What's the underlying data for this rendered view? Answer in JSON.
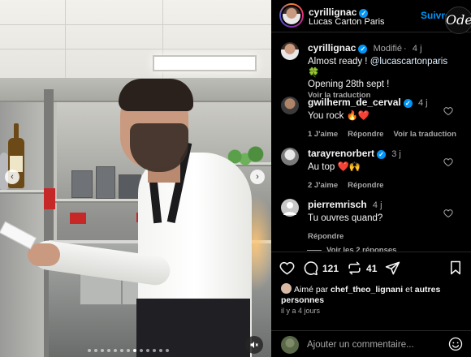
{
  "header": {
    "username": "cyrillignac",
    "location": "Lucas Carton Paris",
    "follow_label": "Suivre",
    "watermark": "Ode"
  },
  "caption": {
    "username": "cyrillignac",
    "modified": "Modifié",
    "time": "4 j",
    "line1": "Almost ready ! ",
    "mention": "@lucascartonparis",
    "clover": "🍀",
    "line2": "Opening 28th sept !",
    "translate": "Voir la traduction"
  },
  "comments": [
    {
      "username": "gwilherm_de_cerval",
      "verified": true,
      "time": "4 j",
      "text": "You rock 🔥❤️",
      "likes": "1 J'aime",
      "reply": "Répondre",
      "translate": "Voir la traduction"
    },
    {
      "username": "tarayrenorbert",
      "verified": true,
      "time": "3 j",
      "text": "Au top ❤️🙌",
      "likes": "2 J'aime",
      "reply": "Répondre"
    },
    {
      "username": "pierremrisch",
      "verified": false,
      "time": "4 j",
      "text": "Tu ouvres quand?",
      "reply": "Répondre"
    }
  ],
  "view_replies": "Voir les 2 réponses",
  "actions": {
    "comment_count": "121",
    "repost_count": "41"
  },
  "likes": {
    "prefix": "Aimé par ",
    "user": "chef_theo_lignani",
    "mid": " et ",
    "rest": "autres personnes"
  },
  "timestamp": "il y a 4 jours",
  "add_comment": {
    "placeholder": "Ajouter un commentaire..."
  },
  "video": {
    "dots_total": 13,
    "active_dot": 7
  },
  "colors": {
    "accent": "#0095f6",
    "like_red": "#ed4956"
  }
}
